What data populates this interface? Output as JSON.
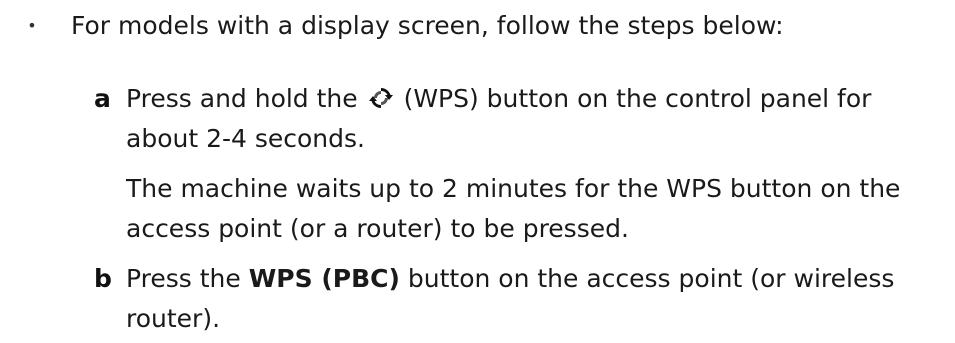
{
  "bullet": {
    "marker": "•",
    "text": "For models with a display screen, follow the steps below:"
  },
  "steps": {
    "a": {
      "letter": "a",
      "line1_before": "Press and hold the",
      "icon": "wps-icon",
      "line1_after": "(WPS) button on the control panel for",
      "line2": "about 2-4 seconds.",
      "note_line1": "The machine waits up to 2 minutes for the WPS button on the",
      "note_line2": "access point (or a router) to be pressed."
    },
    "b": {
      "letter": "b",
      "line1_before": "Press the",
      "line1_bold": "WPS (PBC)",
      "line1_after": "button on the access point (or wireless",
      "line2": "router)."
    }
  }
}
